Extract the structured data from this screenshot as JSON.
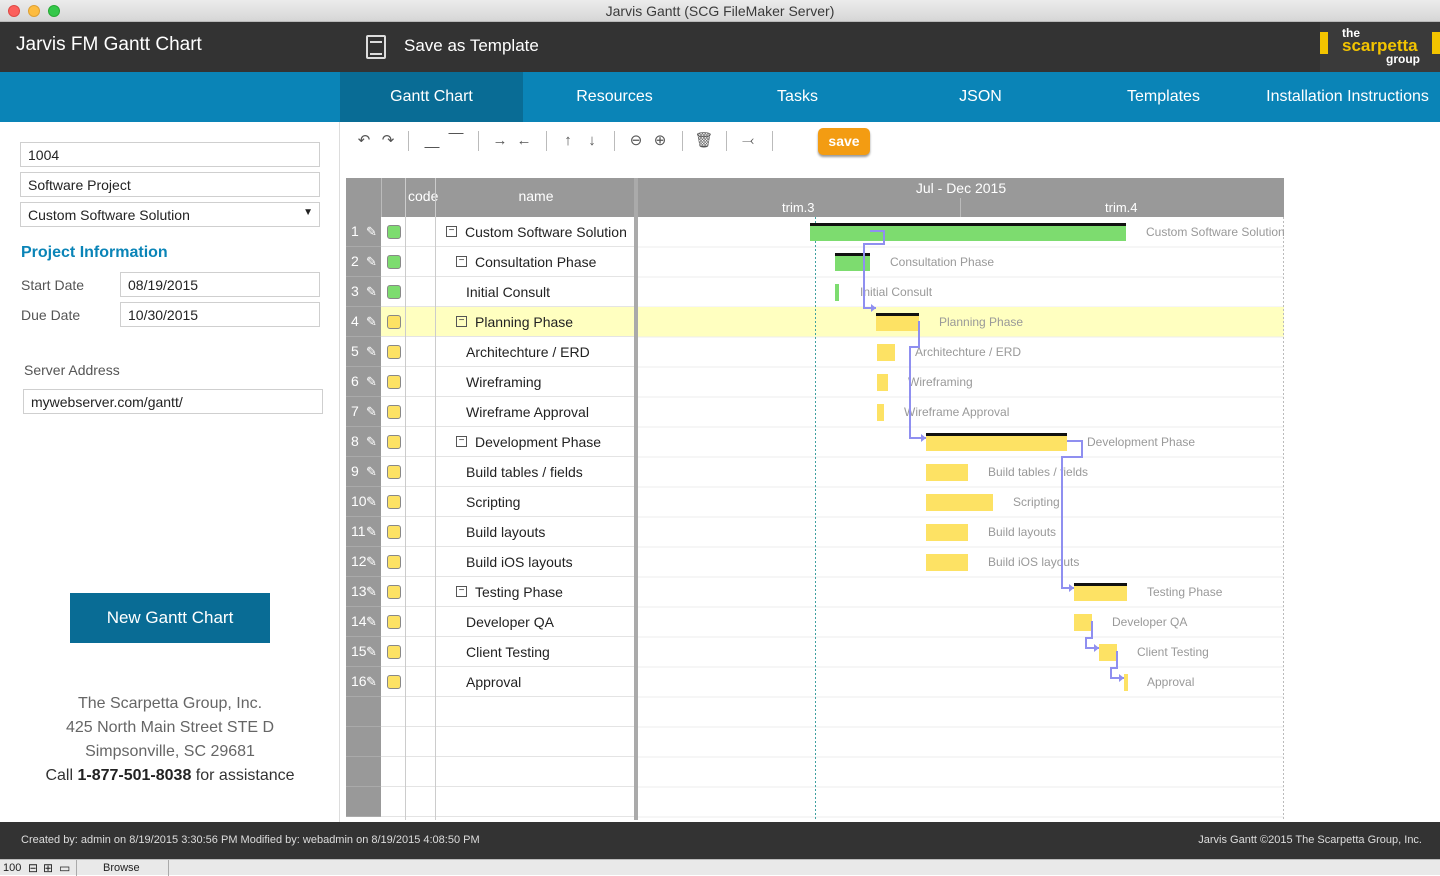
{
  "window": {
    "title": "Jarvis Gantt (SCG FileMaker Server)"
  },
  "header": {
    "app_title": "Jarvis FM Gantt Chart",
    "save_template_label": "Save as Template",
    "logo": {
      "line1": "the",
      "line2": "scarpetta",
      "line3": "group"
    }
  },
  "tabs": [
    {
      "label": "Gantt Chart",
      "active": true
    },
    {
      "label": "Resources",
      "active": false
    },
    {
      "label": "Tasks",
      "active": false
    },
    {
      "label": "JSON",
      "active": false
    },
    {
      "label": "Templates",
      "active": false
    },
    {
      "label": "Installation Instructions",
      "active": false
    }
  ],
  "sidebar": {
    "project_id": "1004",
    "project_name": "Software Project",
    "project_select": "Custom Software Solution",
    "section_title": "Project Information",
    "start_date_label": "Start Date",
    "start_date": "08/19/2015",
    "due_date_label": "Due Date",
    "due_date": "10/30/2015",
    "server_label": "Server Address",
    "server_address": "mywebserver.com/gantt/",
    "new_button": "New Gantt Chart",
    "company": {
      "name": "The Scarpetta Group, Inc.",
      "address1": "425 North Main Street STE D",
      "address2": "Simpsonville, SC 29681",
      "call_prefix": "Call ",
      "phone": "1-877-501-8038",
      "call_suffix": " for assistance"
    }
  },
  "toolbar": {
    "save_label": "save"
  },
  "grid": {
    "col_code": "code",
    "col_name": "name"
  },
  "chart_header": {
    "period": "Jul - Dec 2015",
    "col1": "trim.3",
    "col2": "trim.4"
  },
  "colors": {
    "green": "#7ddc6f",
    "yellow": "#fde264",
    "highlight": "#ffffc0",
    "link": "#8f8ff0",
    "accent": "#0a84b7"
  },
  "tasks": [
    {
      "num": "1",
      "name": "Custom Software Solution",
      "level": 0,
      "group": true,
      "status": "green"
    },
    {
      "num": "2",
      "name": "Consultation Phase",
      "level": 1,
      "group": true,
      "status": "green"
    },
    {
      "num": "3",
      "name": "Initial Consult",
      "level": 2,
      "group": false,
      "status": "green"
    },
    {
      "num": "4",
      "name": "Planning Phase",
      "level": 1,
      "group": true,
      "status": "yellow"
    },
    {
      "num": "5",
      "name": "Architechture / ERD",
      "level": 2,
      "group": false,
      "status": "yellow"
    },
    {
      "num": "6",
      "name": "Wireframing",
      "level": 2,
      "group": false,
      "status": "yellow"
    },
    {
      "num": "7",
      "name": "Wireframe Approval",
      "level": 2,
      "group": false,
      "status": "yellow"
    },
    {
      "num": "8",
      "name": "Development Phase",
      "level": 1,
      "group": true,
      "status": "yellow"
    },
    {
      "num": "9",
      "name": "Build tables / fields",
      "level": 2,
      "group": false,
      "status": "yellow"
    },
    {
      "num": "10",
      "name": "Scripting",
      "level": 2,
      "group": false,
      "status": "yellow"
    },
    {
      "num": "11",
      "name": "Build layouts",
      "level": 2,
      "group": false,
      "status": "yellow"
    },
    {
      "num": "12",
      "name": "Build iOS layouts",
      "level": 2,
      "group": false,
      "status": "yellow"
    },
    {
      "num": "13",
      "name": "Testing Phase",
      "level": 1,
      "group": true,
      "status": "yellow"
    },
    {
      "num": "14",
      "name": "Developer QA",
      "level": 2,
      "group": false,
      "status": "yellow"
    },
    {
      "num": "15",
      "name": "Client Testing",
      "level": 2,
      "group": false,
      "status": "yellow"
    },
    {
      "num": "16",
      "name": "Approval",
      "level": 2,
      "group": false,
      "status": "yellow"
    }
  ],
  "selected_row": 4,
  "footer": {
    "left": "Created by: admin on 8/19/2015 3:30:56 PM Modified by: webadmin on 8/19/2015 4:08:50 PM",
    "right": "Jarvis Gantt ©2015 The Scarpetta Group, Inc."
  },
  "statusbar": {
    "zoom": "100",
    "mode": "Browse"
  }
}
